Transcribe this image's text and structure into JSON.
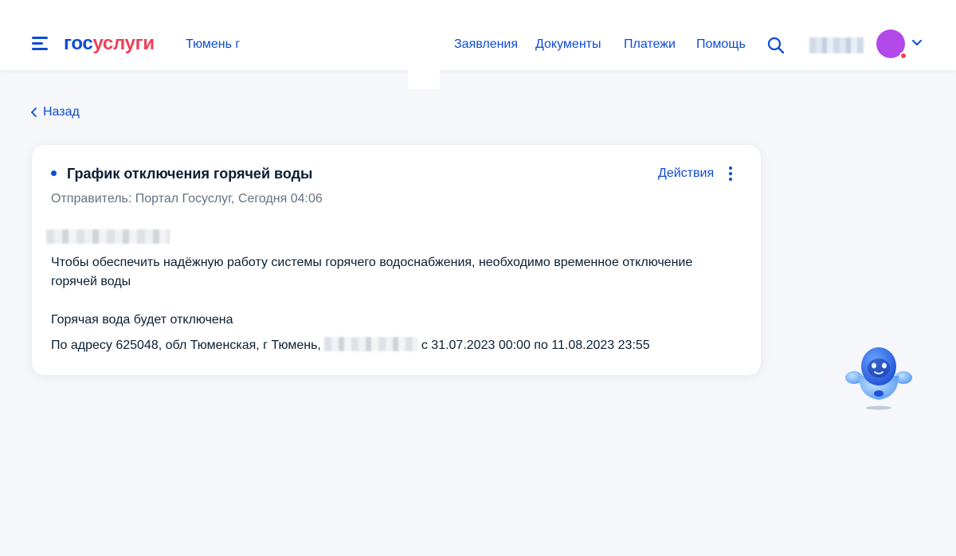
{
  "header": {
    "logo_part1": "гос",
    "logo_part2": "услуги",
    "region": "Тюмень г",
    "nav": [
      "Заявления",
      "Документы",
      "Платежи",
      "Помощь"
    ]
  },
  "back_label": "Назад",
  "card": {
    "title": "График отключения горячей воды",
    "actions_label": "Действия",
    "sender": "Отправитель: Портал Госуслуг, Сегодня 04:06",
    "paragraph1_line1": "Чтобы обеспечить надёжную работу системы горячего водоснабжения, необходимо временное отключение",
    "paragraph1_line2": "горячей воды",
    "paragraph2": "Горячая вода будет отключена",
    "address_prefix": "По адресу 625048, обл Тюменская, г Тюмень,",
    "address_suffix": "с 31.07.2023 00:00 по 11.08.2023 23:55"
  },
  "colors": {
    "brand_blue": "#0d4cd3",
    "brand_red": "#ee3f58",
    "avatar": "#b249e8",
    "page_bg": "#f5f7fb"
  },
  "icons": [
    "menu-icon",
    "search-icon",
    "chevron-down-icon",
    "chevron-left-icon",
    "more-vertical-icon",
    "assistant-robot-icon"
  ]
}
